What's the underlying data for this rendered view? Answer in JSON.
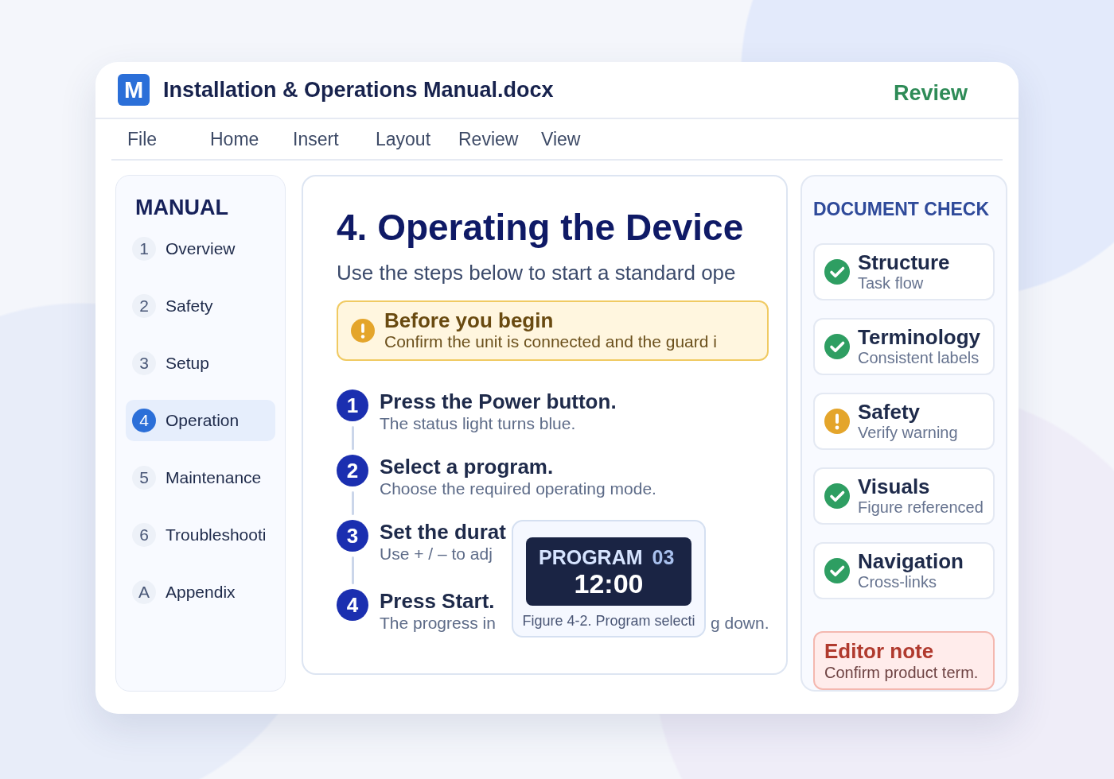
{
  "window": {
    "app_letter": "M",
    "title": "Installation & Operations Manual.docx",
    "mode": "Review"
  },
  "menu": [
    "File",
    "Home",
    "Insert",
    "Layout",
    "Review",
    "View"
  ],
  "sidebar": {
    "title": "MANUAL",
    "items": [
      {
        "number": "1",
        "label": "Overview",
        "selected": false
      },
      {
        "number": "2",
        "label": "Safety",
        "selected": false
      },
      {
        "number": "3",
        "label": "Setup",
        "selected": false
      },
      {
        "number": "4",
        "label": "Operation",
        "selected": true
      },
      {
        "number": "5",
        "label": "Maintenance",
        "selected": false
      },
      {
        "number": "6",
        "label": "Troubleshooti",
        "selected": false
      },
      {
        "number": "A",
        "label": "Appendix",
        "selected": false
      }
    ]
  },
  "content": {
    "heading": "4. Operating the Device",
    "intro": "Use the steps below to start a standard ope",
    "callout": {
      "title": "Before you begin",
      "text": "Confirm the unit is connected and the guard i"
    },
    "steps": [
      {
        "number": "1",
        "title": "Press the Power button.",
        "text": "The status light turns blue."
      },
      {
        "number": "2",
        "title": "Select a program.",
        "text": "Choose the required operating mode."
      },
      {
        "number": "3",
        "title": "Set the durat",
        "text": "Use + / – to adj"
      },
      {
        "number": "4",
        "title": "Press Start.",
        "text": "The progress in",
        "text_end": "g down."
      }
    ],
    "figure": {
      "display": {
        "label": "PROGRAM",
        "value": "03",
        "time": "12:00"
      },
      "caption": "Figure 4-2. Program selecti"
    }
  },
  "checks": {
    "title": "DOCUMENT CHECK",
    "items": [
      {
        "title": "Structure",
        "text": "Task flow",
        "passed": true
      },
      {
        "title": "Terminology",
        "text": "Consistent labels",
        "passed": true
      },
      {
        "title": "Safety",
        "text": "Verify warning",
        "passed": false
      },
      {
        "title": "Visuals",
        "text": "Figure referenced",
        "passed": true
      },
      {
        "title": "Navigation",
        "text": "Cross-links",
        "passed": true
      }
    ],
    "note": {
      "title": "Editor note",
      "text": "Confirm product term."
    }
  }
}
